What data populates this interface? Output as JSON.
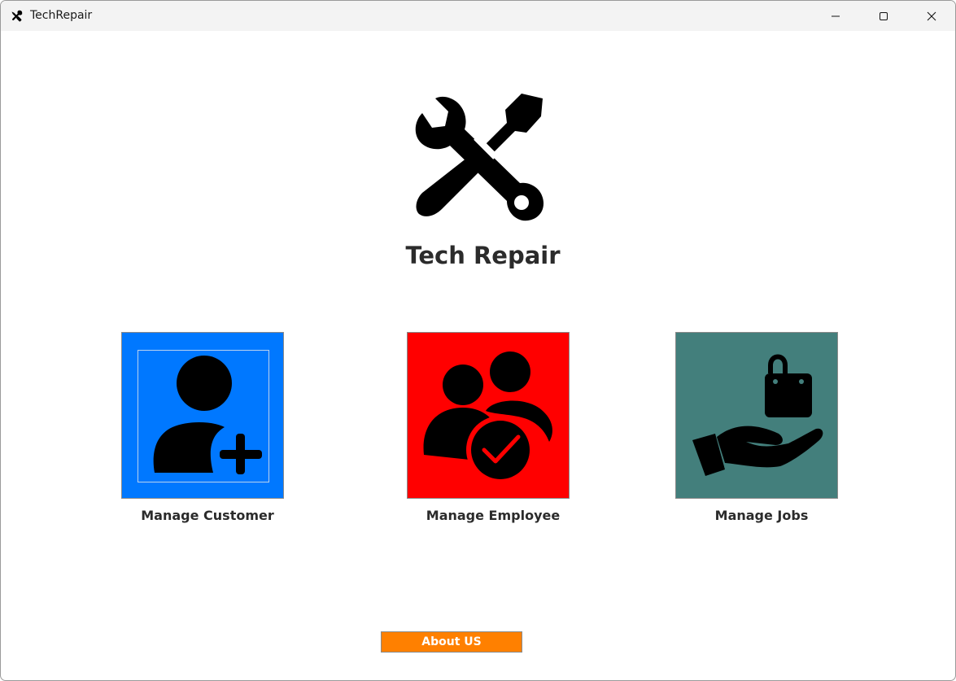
{
  "window": {
    "title": "TechRepair",
    "icon": "tools-icon",
    "controls": {
      "minimize_icon": "minimize-icon",
      "maximize_icon": "maximize-icon",
      "close_icon": "close-icon"
    }
  },
  "main": {
    "logo_icon": "wrench-screwdriver-icon",
    "title": "Tech Repair",
    "tiles": [
      {
        "label": "Manage Customer",
        "icon": "add-user-icon",
        "color": "#0078ff"
      },
      {
        "label": "Manage Employee",
        "icon": "users-check-icon",
        "color": "#ff0000"
      },
      {
        "label": "Manage Jobs",
        "icon": "hand-bag-icon",
        "color": "#437f7c"
      }
    ]
  },
  "footer": {
    "about_label": "About US",
    "about_color": "#ff8000"
  }
}
